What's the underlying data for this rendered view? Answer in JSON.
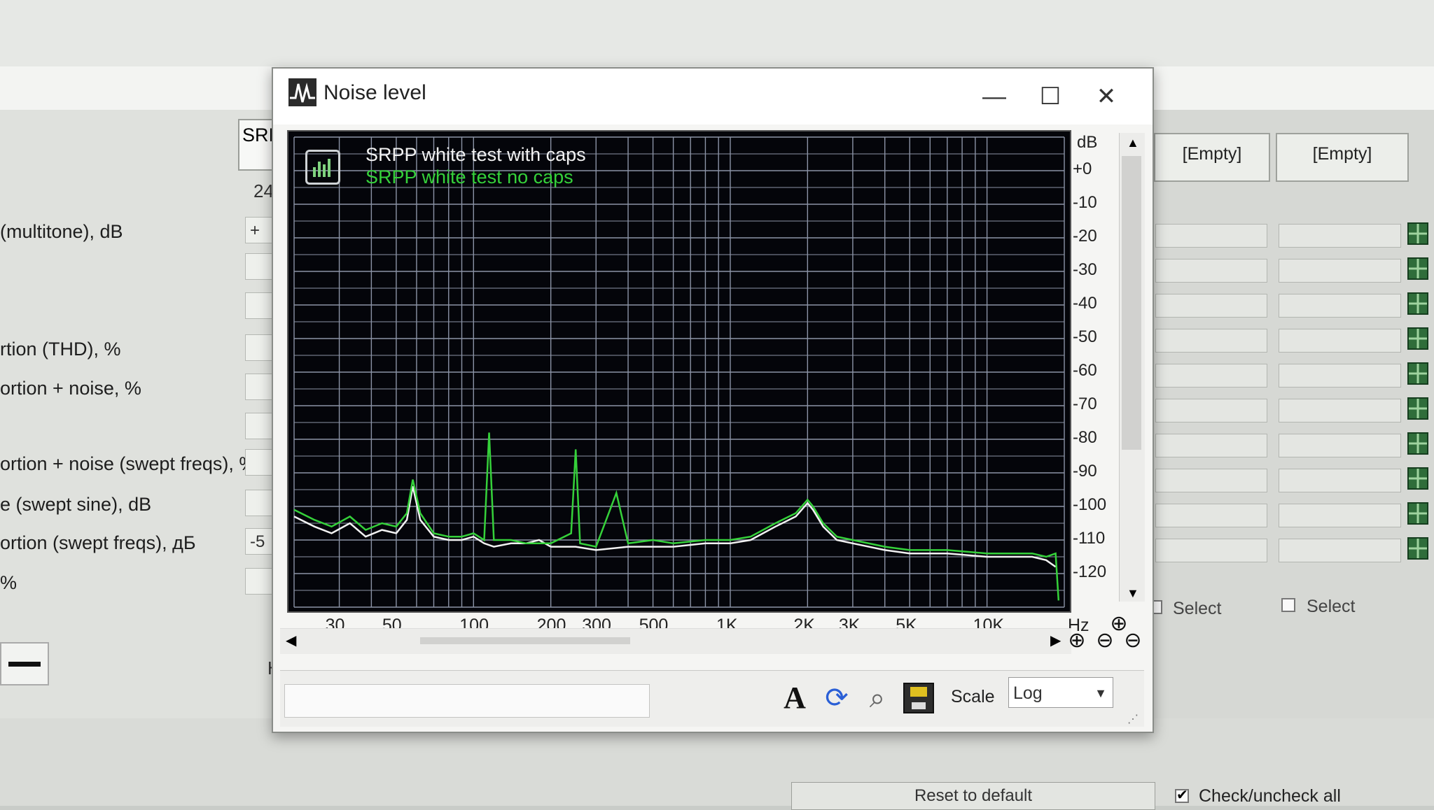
{
  "background_window": {
    "header_cell": "SRI",
    "header_num": "24",
    "rows": [
      {
        "label": "(multitone), dB",
        "field": "+"
      },
      {
        "label": "",
        "field": ""
      },
      {
        "label": "",
        "field": ""
      },
      {
        "label": "rtion (THD), %",
        "field": ""
      },
      {
        "label": "ortion + noise, %",
        "field": ""
      },
      {
        "label": "",
        "field": ""
      },
      {
        "label": "ortion + noise (swept freqs), %",
        "field": ""
      },
      {
        "label": "e (swept sine), dB",
        "field": ""
      },
      {
        "label": "ortion (swept freqs), дБ",
        "field": "-5"
      },
      {
        "label": "%",
        "field": ""
      }
    ],
    "left_button_label": "HI",
    "col_headers": [
      "[Empty]",
      "[Empty]"
    ],
    "select_label": "Select",
    "bottom_left_button": "Reset to default",
    "check_all_label": "Check/uncheck all"
  },
  "dialog": {
    "title": "Noise level",
    "minimize": "—",
    "maximize": "☐",
    "close": "✕",
    "legend": [
      {
        "name": "SRPP white test with caps",
        "color": "#f2f2f2"
      },
      {
        "name": "SRPP white test no caps",
        "color": "#35d13a"
      }
    ],
    "y_unit": "dB",
    "x_unit": "Hz",
    "scale_label": "Scale",
    "scale_value": "Log",
    "toolbar_icons": [
      "font-icon",
      "refresh-icon",
      "search-icon",
      "save-icon"
    ]
  },
  "chart_data": {
    "type": "line",
    "x_scale": "log",
    "xlim": [
      20,
      20000
    ],
    "ylim": [
      -130,
      10
    ],
    "x_ticks": [
      {
        "value": 30,
        "label": "30"
      },
      {
        "value": 50,
        "label": "50"
      },
      {
        "value": 100,
        "label": "100"
      },
      {
        "value": 200,
        "label": "200"
      },
      {
        "value": 300,
        "label": "300"
      },
      {
        "value": 500,
        "label": "500"
      },
      {
        "value": 1000,
        "label": "1K"
      },
      {
        "value": 2000,
        "label": "2K"
      },
      {
        "value": 3000,
        "label": "3K"
      },
      {
        "value": 5000,
        "label": "5K"
      },
      {
        "value": 10000,
        "label": "10K"
      }
    ],
    "y_ticks": [
      {
        "value": 0,
        "label": "+0"
      },
      {
        "value": -10,
        "label": "-10"
      },
      {
        "value": -20,
        "label": "-20"
      },
      {
        "value": -30,
        "label": "-30"
      },
      {
        "value": -40,
        "label": "-40"
      },
      {
        "value": -50,
        "label": "-50"
      },
      {
        "value": -60,
        "label": "-60"
      },
      {
        "value": -70,
        "label": "-70"
      },
      {
        "value": -80,
        "label": "-80"
      },
      {
        "value": -90,
        "label": "-90"
      },
      {
        "value": -100,
        "label": "-100"
      },
      {
        "value": -110,
        "label": "-110"
      },
      {
        "value": -120,
        "label": "-120"
      }
    ],
    "grid": true,
    "series": [
      {
        "name": "SRPP white test with caps",
        "color": "#f2f2f2",
        "x": [
          20,
          24,
          28,
          33,
          38,
          44,
          50,
          55,
          58,
          62,
          70,
          80,
          90,
          100,
          110,
          120,
          140,
          160,
          180,
          200,
          250,
          300,
          400,
          500,
          600,
          800,
          1000,
          1200,
          1500,
          1800,
          2000,
          2100,
          2300,
          2600,
          3000,
          4000,
          5000,
          7000,
          10000,
          12000,
          15000,
          17000,
          18500
        ],
        "y": [
          -103,
          -106,
          -108,
          -105,
          -109,
          -107,
          -108,
          -104,
          -94,
          -104,
          -109,
          -110,
          -110,
          -109,
          -111,
          -112,
          -111,
          -111,
          -110,
          -112,
          -112,
          -113,
          -112,
          -112,
          -112,
          -111,
          -111,
          -110,
          -106,
          -103,
          -99,
          -101,
          -106,
          -110,
          -111,
          -113,
          -114,
          -114,
          -115,
          -115,
          -115,
          -116,
          -118
        ]
      },
      {
        "name": "SRPP white test no caps",
        "color": "#35d13a",
        "x": [
          20,
          24,
          28,
          33,
          38,
          44,
          50,
          55,
          58,
          62,
          70,
          80,
          90,
          100,
          110,
          115,
          120,
          140,
          160,
          180,
          200,
          240,
          250,
          260,
          300,
          360,
          400,
          500,
          600,
          800,
          1000,
          1200,
          1500,
          1800,
          2000,
          2100,
          2300,
          2600,
          3000,
          4000,
          5000,
          7000,
          10000,
          12000,
          15000,
          17000,
          18500,
          19000
        ],
        "y": [
          -101,
          -104,
          -106,
          -103,
          -107,
          -105,
          -106,
          -102,
          -92,
          -102,
          -108,
          -109,
          -109,
          -108,
          -110,
          -78,
          -110,
          -110,
          -111,
          -111,
          -111,
          -108,
          -83,
          -111,
          -112,
          -96,
          -111,
          -110,
          -111,
          -110,
          -110,
          -109,
          -105,
          -102,
          -98,
          -100,
          -105,
          -109,
          -110,
          -112,
          -113,
          -113,
          -114,
          -114,
          -114,
          -115,
          -114,
          -128
        ]
      }
    ]
  }
}
